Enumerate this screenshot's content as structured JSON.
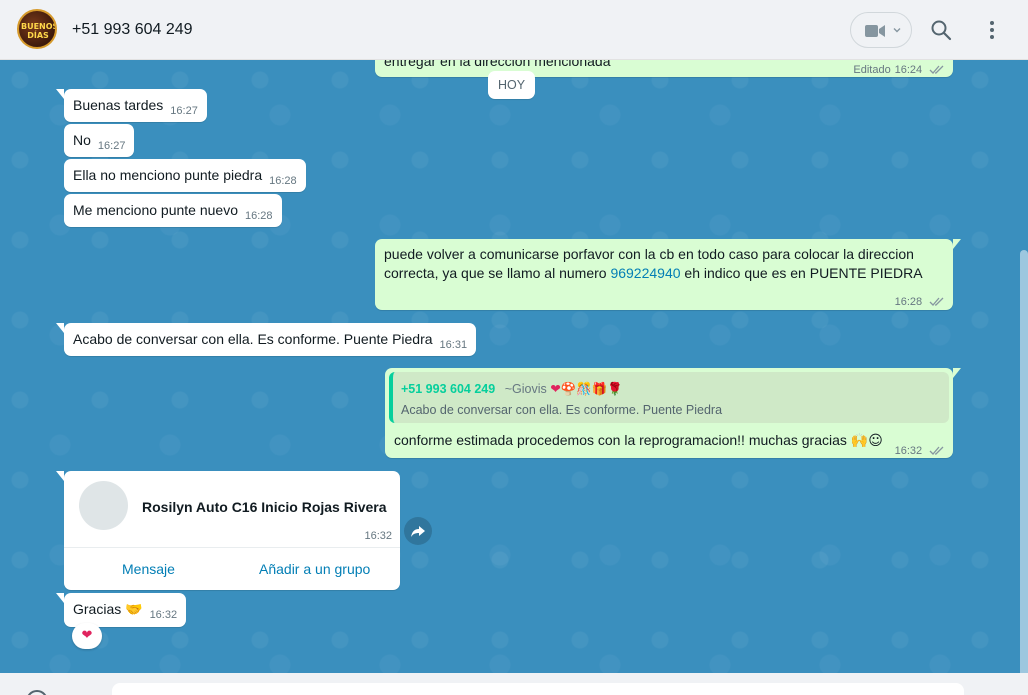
{
  "header": {
    "contact_title": "+51 993 604 249",
    "avatar_text": "BUENOS DÍAS",
    "video_icon": "video-camera-icon",
    "search_icon": "search-icon",
    "menu_icon": "kebab-menu-icon"
  },
  "messages": {
    "prev_out": {
      "text": "entregar en la dirección mencionada",
      "edited": "Editado",
      "time": "16:24"
    },
    "date_divider": "HOY",
    "in1": {
      "text": "Buenas tardes",
      "time": "16:27"
    },
    "in2": {
      "text": "No",
      "time": "16:27"
    },
    "in3": {
      "text": "Ella no menciono punte piedra",
      "time": "16:28"
    },
    "in4": {
      "text": "Me menciono punte nuevo",
      "time": "16:28"
    },
    "out1": {
      "line1": "puede volver a comunicarse porfavor con la cb en todo caso para colocar la direccion",
      "line2_pre": "correcta, ya que se llamo al numero ",
      "phone_link": "969224940",
      "line2_post": " eh indico que es en PUENTE PIEDRA",
      "time": "16:28"
    },
    "in5": {
      "text": "Acabo de conversar con ella. Es conforme. Puente Piedra",
      "time": "16:31"
    },
    "out2": {
      "quote_author": "+51 993 604 249",
      "quote_alias": "~Giovis",
      "quote_emojis": "❤🍄🎊🎁🌹",
      "quote_text": "Acabo de conversar con ella. Es conforme. Puente Piedra",
      "text": "conforme estimada procedemos con la reprogramacion!! muchas gracias",
      "text_emojis": "🙌☺",
      "time": "16:32"
    },
    "contact_card": {
      "name": "Rosilyn Auto C16 Inicio Rojas Rivera",
      "time": "16:32",
      "message_btn": "Mensaje",
      "add_group_btn": "Añadir a un grupo"
    },
    "in6": {
      "text": "Gracias",
      "emoji": "🤝",
      "time": "16:32"
    },
    "reaction": "❤"
  },
  "colors": {
    "chat_bg": "#3a8fbe",
    "incoming": "#ffffff",
    "outgoing": "#d9fdd3",
    "link": "#027eb5",
    "quote_author": "#06cf9c"
  }
}
